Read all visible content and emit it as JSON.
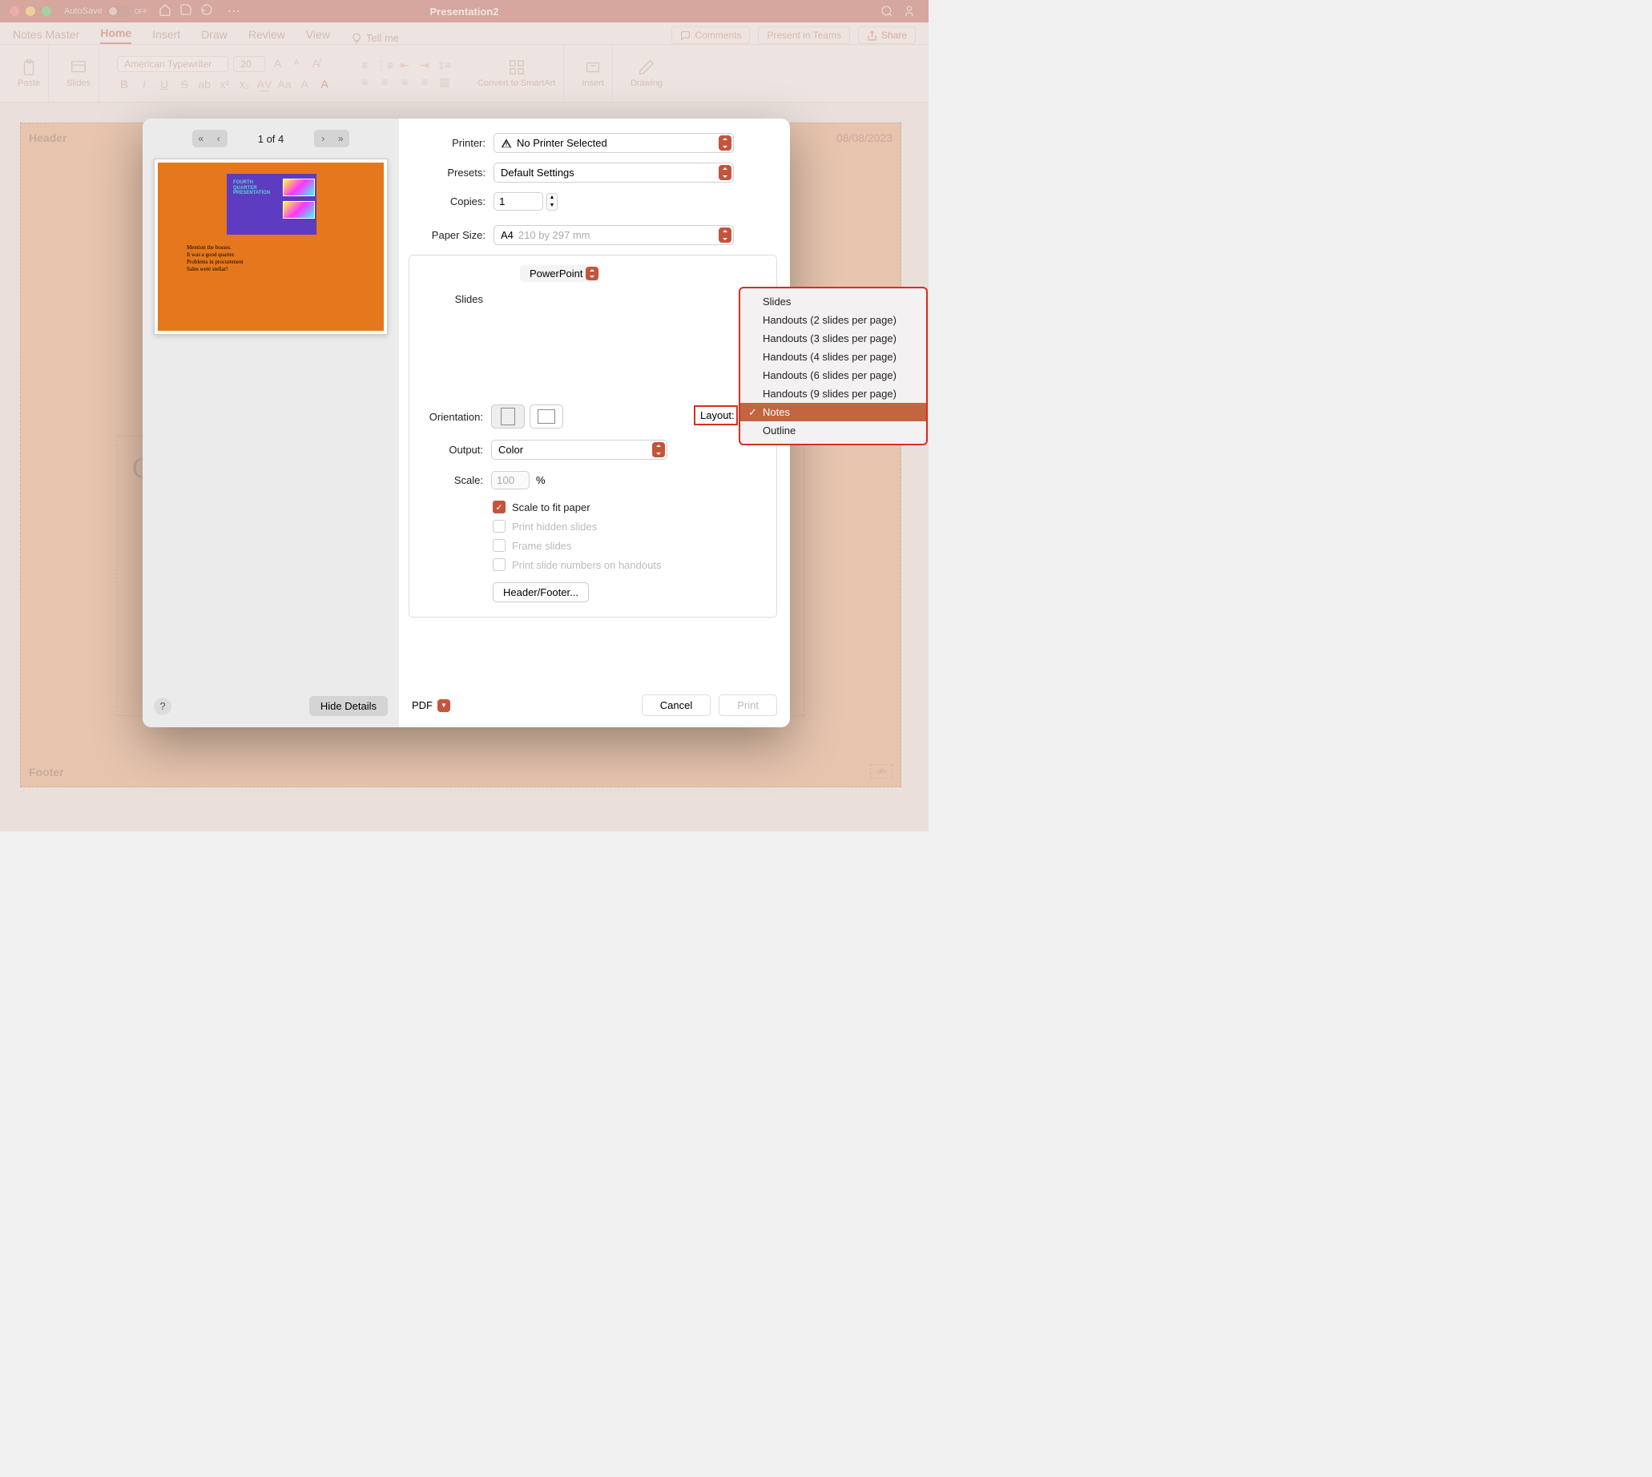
{
  "window": {
    "title": "Presentation2",
    "autosave_label": "AutoSave",
    "autosave_state": "OFF"
  },
  "ribbon": {
    "tabs": [
      "Notes Master",
      "Home",
      "Insert",
      "Draw",
      "Review",
      "View"
    ],
    "active_tab": "Home",
    "tell_me": "Tell me",
    "comments": "Comments",
    "present_teams": "Present in Teams",
    "share": "Share"
  },
  "toolbar": {
    "paste": "Paste",
    "slides": "Slides",
    "font_name": "American Typewriter",
    "font_size": "20",
    "convert_smartart": "Convert to SmartArt",
    "insert": "Insert",
    "drawing": "Drawing"
  },
  "notes_master": {
    "header": "Header",
    "date": "08/08/2023",
    "content_letter": "C",
    "footer": "Footer",
    "pagenum_placeholder": "‹#›"
  },
  "preview": {
    "slide_title": "FOURTH\nQUARTER\nPRESENTATION",
    "notes": [
      "Mention the bosses.",
      "It was a good quarter.",
      "Problems in procurement",
      "Sales were stellar!"
    ]
  },
  "print": {
    "pager": "1 of 4",
    "hide_details": "Hide Details",
    "labels": {
      "printer": "Printer:",
      "presets": "Presets:",
      "copies": "Copies:",
      "paper_size": "Paper Size:",
      "slides": "Slides",
      "layout": "Layout:",
      "orientation": "Orientation:",
      "output": "Output:",
      "scale": "Scale:"
    },
    "printer_value": "No Printer Selected",
    "presets_value": "Default Settings",
    "copies_value": "1",
    "paper_size_value": "A4",
    "paper_size_dim": "210 by 297 mm",
    "app_name": "PowerPoint",
    "output_value": "Color",
    "scale_value": "100",
    "scale_unit": "%",
    "scale_to_fit": "Scale to fit paper",
    "print_hidden": "Print hidden slides",
    "frame_slides": "Frame slides",
    "print_numbers": "Print slide numbers on handouts",
    "header_footer": "Header/Footer...",
    "pdf": "PDF",
    "cancel": "Cancel",
    "print_btn": "Print"
  },
  "layout_options": [
    "Slides",
    "Handouts (2 slides per page)",
    "Handouts (3 slides per page)",
    "Handouts (4 slides per page)",
    "Handouts (6 slides per page)",
    "Handouts (9 slides per page)",
    "Notes",
    "Outline"
  ],
  "layout_selected": "Notes"
}
